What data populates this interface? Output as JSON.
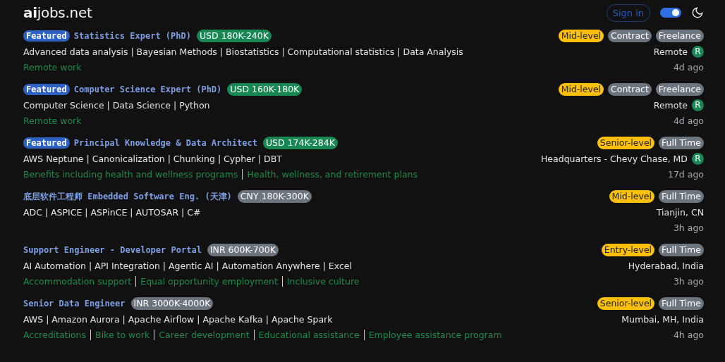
{
  "header": {
    "logo": "**ai**jobs.net",
    "sign_in": "Sign in",
    "theme_switch": {
      "on": true
    }
  },
  "jobs": [
    {
      "featured": true,
      "featured_label": "Featured",
      "title": "Statistics Expert (PhD)",
      "salary": {
        "text": "USD 180K-240K",
        "color": "#198754"
      },
      "tags": [
        {
          "kind": "level",
          "text": "Mid-level"
        },
        {
          "kind": "type",
          "text": "Contract"
        },
        {
          "kind": "type",
          "text": "Freelance"
        }
      ],
      "skills": "Advanced data analysis | Bayesian Methods | Biostatistics | Computational statistics | Data Analysis",
      "benefits": [
        "Remote work"
      ],
      "location": "Remote",
      "remote_badge": "R",
      "posted": "4d ago"
    },
    {
      "featured": true,
      "featured_label": "Featured",
      "title": "Computer Science Expert (PhD)",
      "salary": {
        "text": "USD 160K-180K",
        "color": "#198754"
      },
      "tags": [
        {
          "kind": "level",
          "text": "Mid-level"
        },
        {
          "kind": "type",
          "text": "Contract"
        },
        {
          "kind": "type",
          "text": "Freelance"
        }
      ],
      "skills": "Computer Science | Data Science | Python",
      "benefits": [
        "Remote work"
      ],
      "location": "Remote",
      "remote_badge": "R",
      "posted": "4d ago"
    },
    {
      "featured": true,
      "featured_label": "Featured",
      "title": "Principal Knowledge & Data Architect",
      "salary": {
        "text": "USD 174K-284K",
        "color": "#198754"
      },
      "tags": [
        {
          "kind": "level",
          "text": "Senior-level"
        },
        {
          "kind": "type",
          "text": "Full Time"
        }
      ],
      "skills": "AWS Neptune | Canonicalization | Chunking | Cypher | DBT",
      "benefits": [
        "Benefits including health and wellness programs",
        "Health, wellness, and retirement plans"
      ],
      "location": "Headquarters - Chevy Chase, MD",
      "remote_badge": "R",
      "posted": "17d ago"
    },
    {
      "featured": false,
      "title": "底层软件工程师 Embedded Software Eng. (天津)",
      "salary": {
        "text": "CNY 180K-300K",
        "color": "#6c757d"
      },
      "tags": [
        {
          "kind": "level",
          "text": "Mid-level"
        },
        {
          "kind": "type",
          "text": "Full Time"
        }
      ],
      "skills": "ADC | ASPICE | ASPinCE | AUTOSAR | C#",
      "location": "Tianjin, CN",
      "posted": "3h ago"
    },
    {
      "featured": false,
      "title": "Support Engineer - Developer Portal",
      "salary": {
        "text": "INR 600K-700K",
        "color": "#6c757d"
      },
      "tags": [
        {
          "kind": "level",
          "text": "Entry-level"
        },
        {
          "kind": "type",
          "text": "Full Time"
        }
      ],
      "skills": "AI Automation | API Integration | Agentic AI | Automation Anywhere | Excel",
      "benefits": [
        "Accommodation support",
        "Equal opportunity employment",
        "Inclusive culture"
      ],
      "location": "Hyderabad, India",
      "posted": "3h ago"
    },
    {
      "featured": false,
      "title": "Senior Data Engineer",
      "salary": {
        "text": "INR 3000K-4000K",
        "color": "#6c757d"
      },
      "tags": [
        {
          "kind": "level",
          "text": "Senior-level"
        },
        {
          "kind": "type",
          "text": "Full Time"
        }
      ],
      "skills": "AWS | Amazon Aurora | Apache Airflow | Apache Kafka | Apache Spark",
      "benefits": [
        "Accreditations",
        "Bike to work",
        "Career development",
        "Educational assistance",
        "Employee assistance program"
      ],
      "location": "Mumbai, MH, India",
      "posted": "4h ago"
    }
  ]
}
